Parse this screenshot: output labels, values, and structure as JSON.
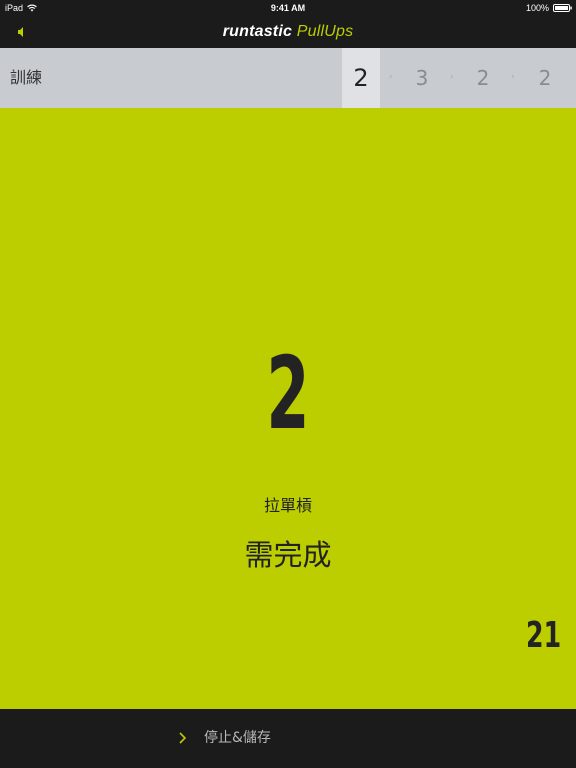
{
  "status_bar": {
    "carrier": "iPad",
    "time": "9:41 AM",
    "battery": "100%"
  },
  "nav": {
    "brand": "runtastic",
    "product": "PullUps",
    "sound_icon": "speaker-icon"
  },
  "sets_bar": {
    "label": "訓練",
    "sets": [
      "2",
      "3",
      "2",
      "2"
    ],
    "active_index": 0,
    "separator_icon": "chevron-right-icon"
  },
  "main": {
    "reps": "2",
    "exercise": "拉單槓",
    "status": "需完成",
    "total": "21"
  },
  "bottom": {
    "stop_label": "停止&儲存",
    "chevron_icon": "chevron-right-icon"
  },
  "colors": {
    "accent": "#bccd00",
    "bar": "#1b1b1b",
    "sets_bg": "#c8ccd1",
    "active_set_bg": "#dfe1e4"
  }
}
